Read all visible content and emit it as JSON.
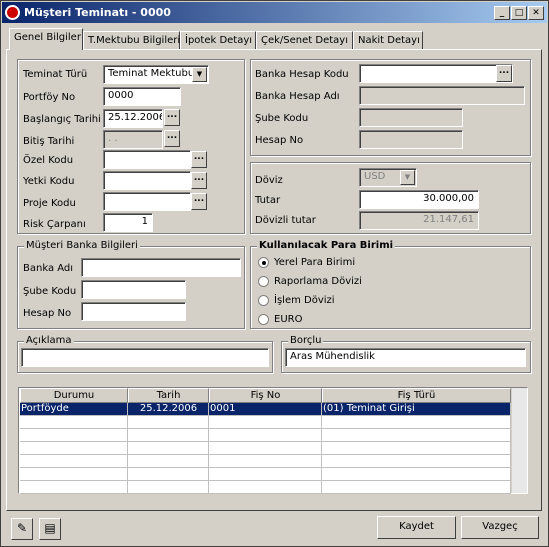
{
  "window": {
    "title": "Müşteri Teminatı - 0000"
  },
  "tabs": [
    "Genel Bilgiler",
    "T.Mektubu Bilgileri",
    "İpotek Detayı",
    "Çek/Senet Detayı",
    "Nakit Detayı"
  ],
  "form": {
    "teminat_turu_label": "Teminat Türü",
    "teminat_turu_value": "Teminat Mektubu",
    "portfoy_no_label": "Portföy No",
    "portfoy_no_value": "0000",
    "baslangic_label": "Başlangıç Tarihi",
    "baslangic_value": "25.12.2006",
    "bitis_label": "Bitiş Tarihi",
    "bitis_value": " .  .",
    "ozel_kodu_label": "Özel Kodu",
    "ozel_kodu_value": "",
    "yetki_kodu_label": "Yetki Kodu",
    "yetki_kodu_value": "",
    "proje_kodu_label": "Proje Kodu",
    "proje_kodu_value": "",
    "risk_label": "Risk Çarpanı",
    "risk_value": "1"
  },
  "bank": {
    "banka_hesap_kodu_label": "Banka Hesap Kodu",
    "banka_hesap_kodu_value": "",
    "banka_hesap_adi_label": "Banka Hesap Adı",
    "banka_hesap_adi_value": "",
    "sube_kodu_label": "Şube Kodu",
    "sube_kodu_value": "",
    "hesap_no_label": "Hesap No",
    "hesap_no_value": ""
  },
  "currency": {
    "doviz_label": "Döviz",
    "doviz_value": "USD",
    "tutar_label": "Tutar",
    "tutar_value": "30.000,00",
    "dovizli_label": "Dövizli tutar",
    "dovizli_value": "21.147,61"
  },
  "musteri_banka": {
    "title": "Müşteri Banka Bilgileri",
    "banka_adi_label": "Banka Adı",
    "banka_adi_value": "",
    "sube_kodu_label": "Şube Kodu",
    "sube_kodu_value": "",
    "hesap_no_label": "Hesap No",
    "hesap_no_value": ""
  },
  "para_birimi": {
    "title": "Kullanılacak Para Birimi",
    "options": [
      "Yerel Para Birimi",
      "Raporlama Dövizi",
      "İşlem Dövizi",
      "EURO"
    ],
    "selected": "Yerel Para Birimi"
  },
  "aciklama": {
    "title": "Açıklama",
    "value": ""
  },
  "borclu": {
    "title": "Borçlu",
    "value": "Aras Mühendislik"
  },
  "grid": {
    "columns": [
      "Durumu",
      "Tarih",
      "Fiş No",
      "Fiş Türü"
    ],
    "rows": [
      [
        "Portföyde",
        "25.12.2006",
        "0001",
        "(01) Teminat Girişi"
      ]
    ]
  },
  "buttons": {
    "save": "Kaydet",
    "cancel": "Vazgeç"
  }
}
